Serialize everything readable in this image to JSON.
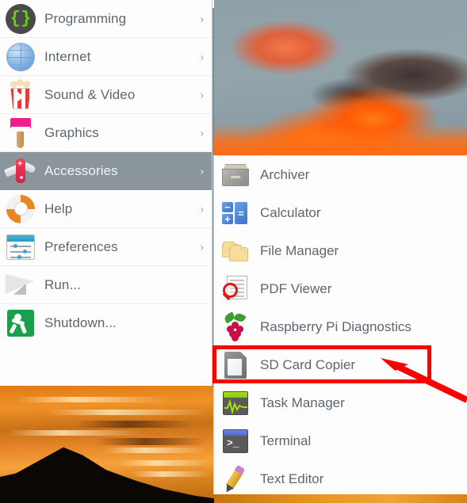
{
  "desktop": {
    "wallpaper_description": "sunset clouds over mountain silhouette",
    "sky_color": "#8ea0a8",
    "cloud_fire_color": "#ff6a14",
    "sunset_color": "#e8882a",
    "mountain_color": "#0a0705"
  },
  "main_menu": {
    "items": [
      {
        "label": "Programming",
        "icon": "code-braces-icon",
        "has_submenu": true,
        "selected": false
      },
      {
        "label": "Internet",
        "icon": "globe-icon",
        "has_submenu": true,
        "selected": false
      },
      {
        "label": "Sound & Video",
        "icon": "popcorn-icon",
        "has_submenu": true,
        "selected": false
      },
      {
        "label": "Graphics",
        "icon": "paintbrush-icon",
        "has_submenu": true,
        "selected": false
      },
      {
        "label": "Accessories",
        "icon": "swiss-army-knife-icon",
        "has_submenu": true,
        "selected": true
      },
      {
        "label": "Help",
        "icon": "lifebuoy-icon",
        "has_submenu": true,
        "selected": false
      },
      {
        "label": "Preferences",
        "icon": "sliders-icon",
        "has_submenu": true,
        "selected": false
      },
      {
        "label": "Run...",
        "icon": "paper-plane-icon",
        "has_submenu": false,
        "selected": false
      },
      {
        "label": "Shutdown...",
        "icon": "exit-sign-icon",
        "has_submenu": false,
        "selected": false
      }
    ],
    "submenu_arrow": "›",
    "highlight_color": "#8b959c",
    "text_color": "#5c6770"
  },
  "submenu": {
    "parent": "Accessories",
    "items": [
      {
        "label": "Archiver",
        "icon": "archive-drawer-icon"
      },
      {
        "label": "Calculator",
        "icon": "calculator-icon"
      },
      {
        "label": "File Manager",
        "icon": "folder-icon"
      },
      {
        "label": "PDF Viewer",
        "icon": "pdf-magnifier-icon"
      },
      {
        "label": "Raspberry Pi Diagnostics",
        "icon": "raspberry-pi-icon"
      },
      {
        "label": "SD Card Copier",
        "icon": "sd-card-icon"
      },
      {
        "label": "Task Manager",
        "icon": "task-monitor-icon"
      },
      {
        "label": "Terminal",
        "icon": "terminal-icon"
      },
      {
        "label": "Text Editor",
        "icon": "pencil-icon"
      }
    ]
  },
  "annotation": {
    "highlight_target": "SD Card Copier",
    "highlight_color": "#fb0000",
    "arrow_color": "#fb0000",
    "arrow_direction": "up-left"
  }
}
